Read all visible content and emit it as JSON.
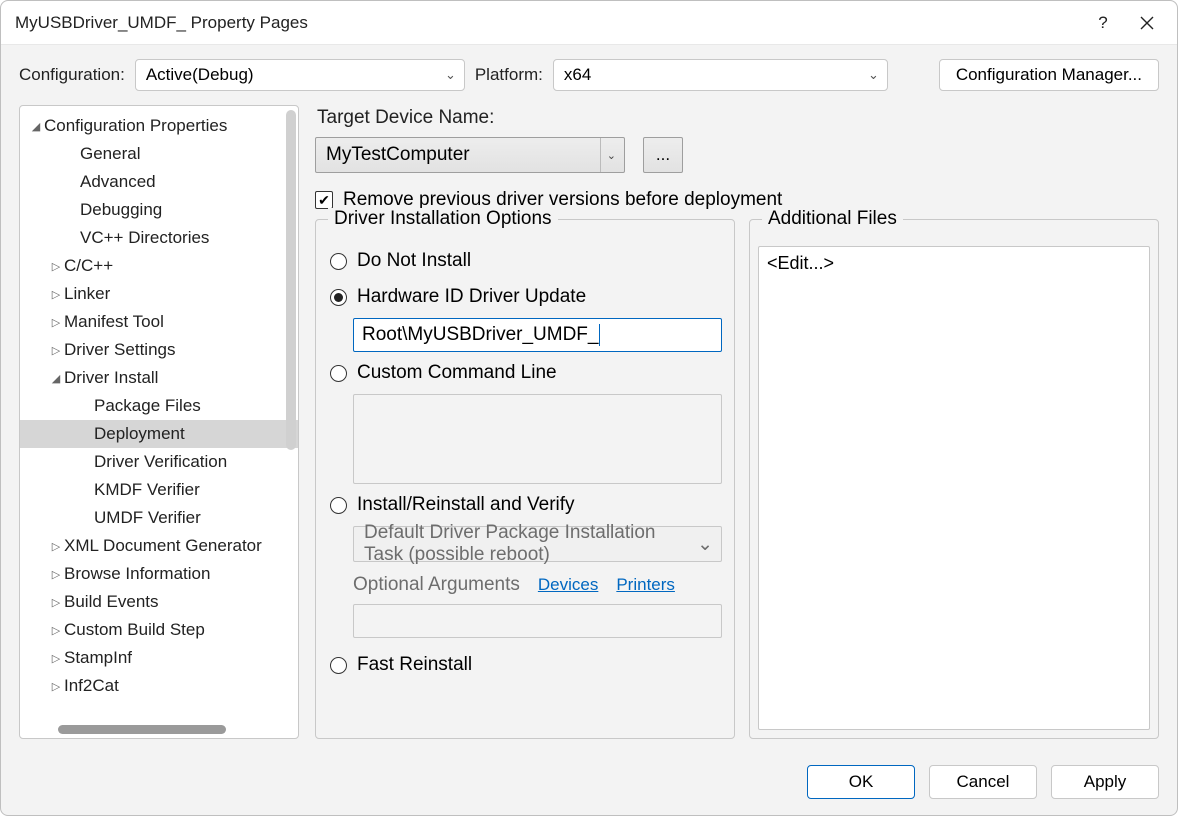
{
  "window": {
    "title": "MyUSBDriver_UMDF_ Property Pages"
  },
  "toolbar": {
    "config_label": "Configuration:",
    "config_value": "Active(Debug)",
    "platform_label": "Platform:",
    "platform_value": "x64",
    "manager_btn": "Configuration Manager..."
  },
  "tree": {
    "root": "Configuration Properties",
    "items": [
      {
        "label": "General",
        "indent": 44,
        "expander": ""
      },
      {
        "label": "Advanced",
        "indent": 44,
        "expander": ""
      },
      {
        "label": "Debugging",
        "indent": 44,
        "expander": ""
      },
      {
        "label": "VC++ Directories",
        "indent": 44,
        "expander": ""
      },
      {
        "label": "C/C++",
        "indent": 28,
        "expander": "▷"
      },
      {
        "label": "Linker",
        "indent": 28,
        "expander": "▷"
      },
      {
        "label": "Manifest Tool",
        "indent": 28,
        "expander": "▷"
      },
      {
        "label": "Driver Settings",
        "indent": 28,
        "expander": "▷"
      },
      {
        "label": "Driver Install",
        "indent": 28,
        "expander": "◢"
      },
      {
        "label": "Package Files",
        "indent": 58,
        "expander": ""
      },
      {
        "label": "Deployment",
        "indent": 58,
        "expander": "",
        "selected": true
      },
      {
        "label": "Driver Verification",
        "indent": 58,
        "expander": ""
      },
      {
        "label": "KMDF Verifier",
        "indent": 58,
        "expander": ""
      },
      {
        "label": "UMDF Verifier",
        "indent": 58,
        "expander": ""
      },
      {
        "label": "XML Document Generator",
        "indent": 28,
        "expander": "▷"
      },
      {
        "label": "Browse Information",
        "indent": 28,
        "expander": "▷"
      },
      {
        "label": "Build Events",
        "indent": 28,
        "expander": "▷"
      },
      {
        "label": "Custom Build Step",
        "indent": 28,
        "expander": "▷"
      },
      {
        "label": "StampInf",
        "indent": 28,
        "expander": "▷"
      },
      {
        "label": "Inf2Cat",
        "indent": 28,
        "expander": "▷"
      }
    ]
  },
  "content": {
    "target_label": "Target Device Name:",
    "target_value": "MyTestComputer",
    "dots": "...",
    "remove_label": "Remove previous driver versions before deployment",
    "group_title": "Driver Installation Options",
    "opt_do_not_install": "Do Not Install",
    "opt_hwid": "Hardware ID Driver Update",
    "hwid_value": "Root\\MyUSBDriver_UMDF_",
    "opt_custom": "Custom Command Line",
    "opt_install_verify": "Install/Reinstall and Verify",
    "install_task": "Default Driver Package Installation Task (possible reboot)",
    "optargs_label": "Optional Arguments",
    "link_devices": "Devices",
    "link_printers": "Printers",
    "opt_fast": "Fast Reinstall",
    "add_files_title": "Additional Files",
    "edit_placeholder": "<Edit...>"
  },
  "footer": {
    "ok": "OK",
    "cancel": "Cancel",
    "apply": "Apply"
  }
}
